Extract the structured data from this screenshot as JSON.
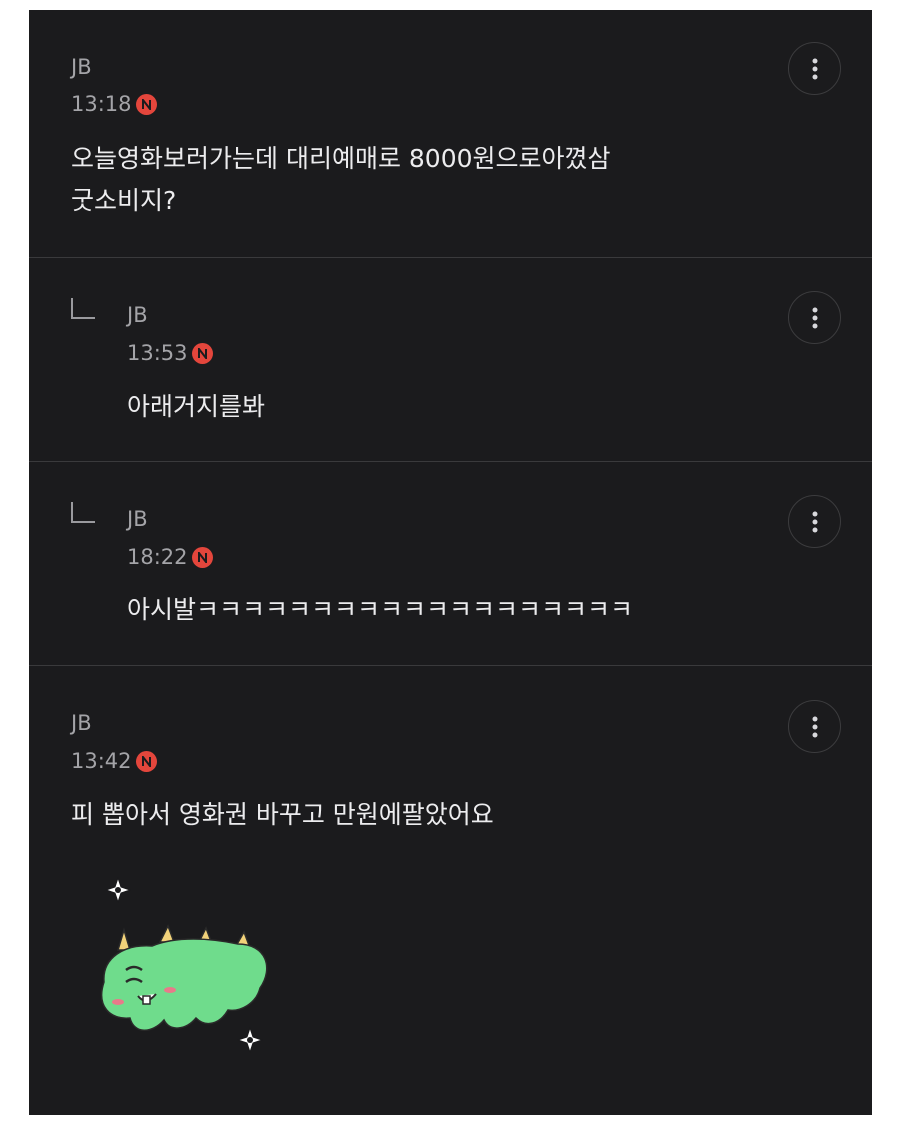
{
  "comments": [
    {
      "author": "JB",
      "time": "13:18",
      "badge": "N",
      "text_lines": [
        "오늘영화보러가는데 대리예매로 8000원으로아꼈삼",
        "굿소비지?"
      ],
      "is_reply": false
    },
    {
      "author": "JB",
      "time": "13:53",
      "badge": "N",
      "text_lines": [
        "아래거지를봐"
      ],
      "is_reply": true
    },
    {
      "author": "JB",
      "time": "18:22",
      "badge": "N",
      "text_lines": [
        "아시발ㅋㅋㅋㅋㅋㅋㅋㅋㅋㅋㅋㅋㅋㅋㅋㅋㅋㅋㅋ"
      ],
      "is_reply": true
    },
    {
      "author": "JB",
      "time": "13:42",
      "badge": "N",
      "text_lines": [
        "피 뽑아서 영화권 바꾸고 만원에팔았어요"
      ],
      "is_reply": false
    }
  ],
  "icons": {
    "more": "more-vertical-icon",
    "reply": "reply-arrow-icon",
    "new": "new-badge-icon"
  },
  "colors": {
    "background": "#1b1b1d",
    "badge": "#e4463c",
    "text": "#ececee",
    "meta": "#a4a4a8",
    "sticker_body": "#6fdc8c"
  }
}
